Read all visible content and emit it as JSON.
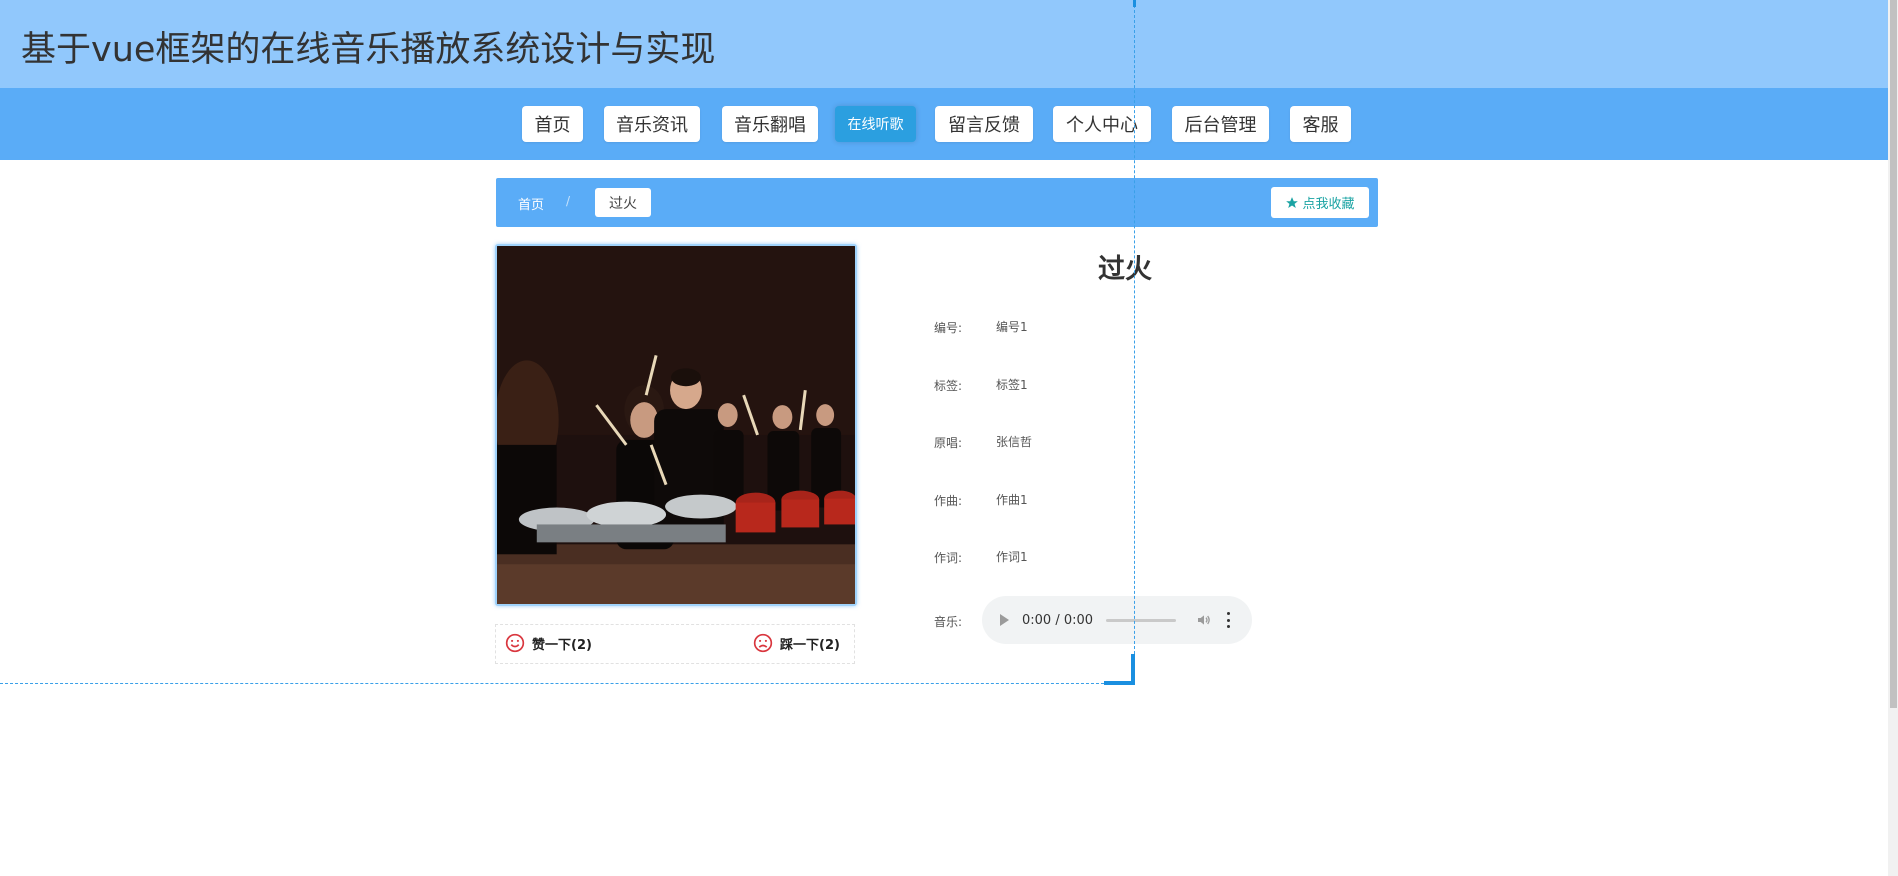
{
  "header": {
    "site_title": "基于vue框架的在线音乐播放系统设计与实现"
  },
  "nav": {
    "items": [
      {
        "label": "首页"
      },
      {
        "label": "音乐资讯"
      },
      {
        "label": "音乐翻唱"
      },
      {
        "label": "在线听歌",
        "active": true
      },
      {
        "label": "留言反馈"
      },
      {
        "label": "个人中心"
      },
      {
        "label": "后台管理"
      },
      {
        "label": "客服"
      }
    ]
  },
  "breadcrumb": {
    "home": "首页",
    "separator": "/",
    "current": "过火",
    "favorite_label": "点我收藏",
    "favorite_icon": "star-icon"
  },
  "song": {
    "title": "过火",
    "fields": [
      {
        "label": "编号:",
        "value": "编号1"
      },
      {
        "label": "标签:",
        "value": "标签1"
      },
      {
        "label": "原唱:",
        "value": "张信哲"
      },
      {
        "label": "作曲:",
        "value": "作曲1"
      },
      {
        "label": "作词:",
        "value": "作词1"
      }
    ],
    "music_label": "音乐:",
    "audio_time": "0:00 / 0:00"
  },
  "votes": {
    "like_label": "赞一下(2)",
    "like_icon": "smile-icon",
    "dislike_label": "踩一下(2)",
    "dislike_icon": "frown-icon"
  },
  "colors": {
    "header_bg": "#91c8fc",
    "nav_bg": "#5aacf7",
    "active_nav": "#2b9fe0",
    "favorite_text": "#1aa3a3",
    "vote_icon": "#d9363e"
  }
}
